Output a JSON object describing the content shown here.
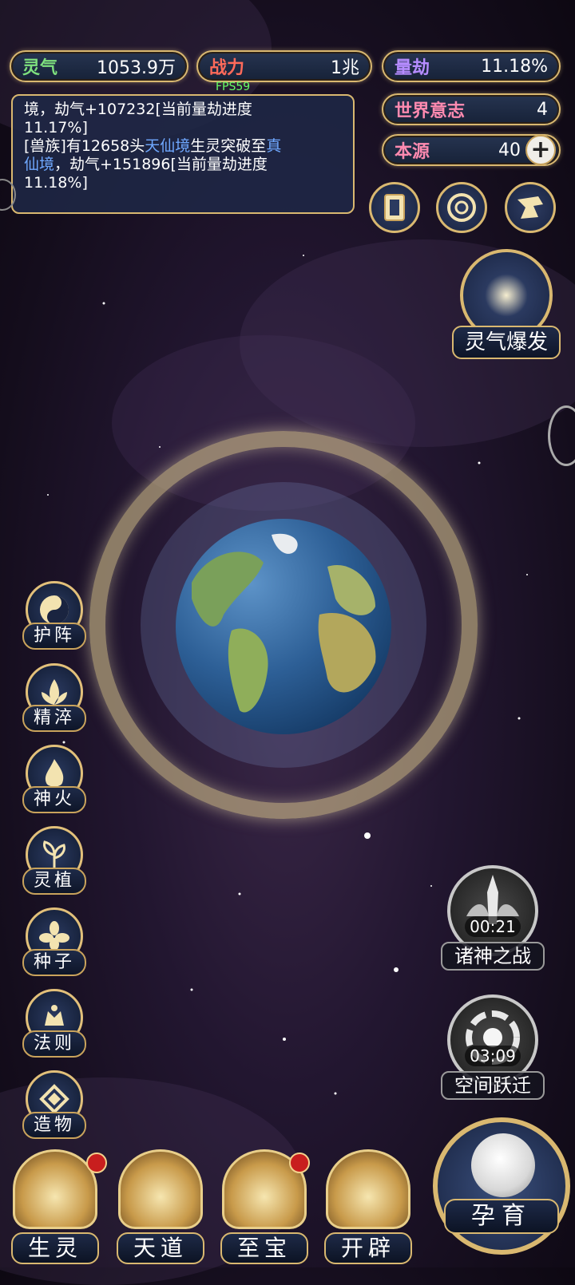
{
  "stats": {
    "lingqi": {
      "label": "灵气",
      "value": "1053.9万",
      "label_color": "#7ee07e"
    },
    "zhanli": {
      "label": "战力",
      "value": "1兆",
      "label_color": "#ff6a5a"
    },
    "liangjie": {
      "label": "量劫",
      "value": "11.18%",
      "label_color": "#b58cff"
    },
    "world_will": {
      "label": "世界意志",
      "value": "4",
      "label_color": "#ff8ab0"
    },
    "source": {
      "label": "本源",
      "value": "40",
      "label_color": "#ff8ab0"
    }
  },
  "fps": "FPS59",
  "log": {
    "line1_a": "境，劫气+107232[当前量劫进度",
    "line1_b": "11.17%]",
    "line2_a": "[兽族]有12658头",
    "line2_blue1": "天仙境",
    "line2_b": "生灵突破至",
    "line2_blue2": "真",
    "line3_blue": "仙境",
    "line3_a": "，劫气+151896[当前量劫进度",
    "line4": "11.18%]"
  },
  "top_icons": [
    "cards-icon",
    "vortex-icon",
    "scroll-icon"
  ],
  "burst": {
    "label": "灵气爆发"
  },
  "skills": [
    {
      "label": "护阵",
      "icon": "yin-yang-icon"
    },
    {
      "label": "精淬",
      "icon": "lotus-flame-icon"
    },
    {
      "label": "神火",
      "icon": "fire-icon"
    },
    {
      "label": "灵植",
      "icon": "plant-icon"
    },
    {
      "label": "种子",
      "icon": "seed-flower-icon"
    },
    {
      "label": "法则",
      "icon": "rule-icon"
    },
    {
      "label": "造物",
      "icon": "creation-icon"
    }
  ],
  "events": [
    {
      "label": "诸神之战",
      "timer": "00:21",
      "icon": "sword-wings-icon"
    },
    {
      "label": "空间跃迁",
      "timer": "03:09",
      "icon": "portal-icon"
    }
  ],
  "nav": [
    {
      "label": "生灵",
      "badge": true
    },
    {
      "label": "天道",
      "badge": false
    },
    {
      "label": "至宝",
      "badge": true
    },
    {
      "label": "开辟",
      "badge": false
    }
  ],
  "nurture": {
    "label": "孕育"
  }
}
